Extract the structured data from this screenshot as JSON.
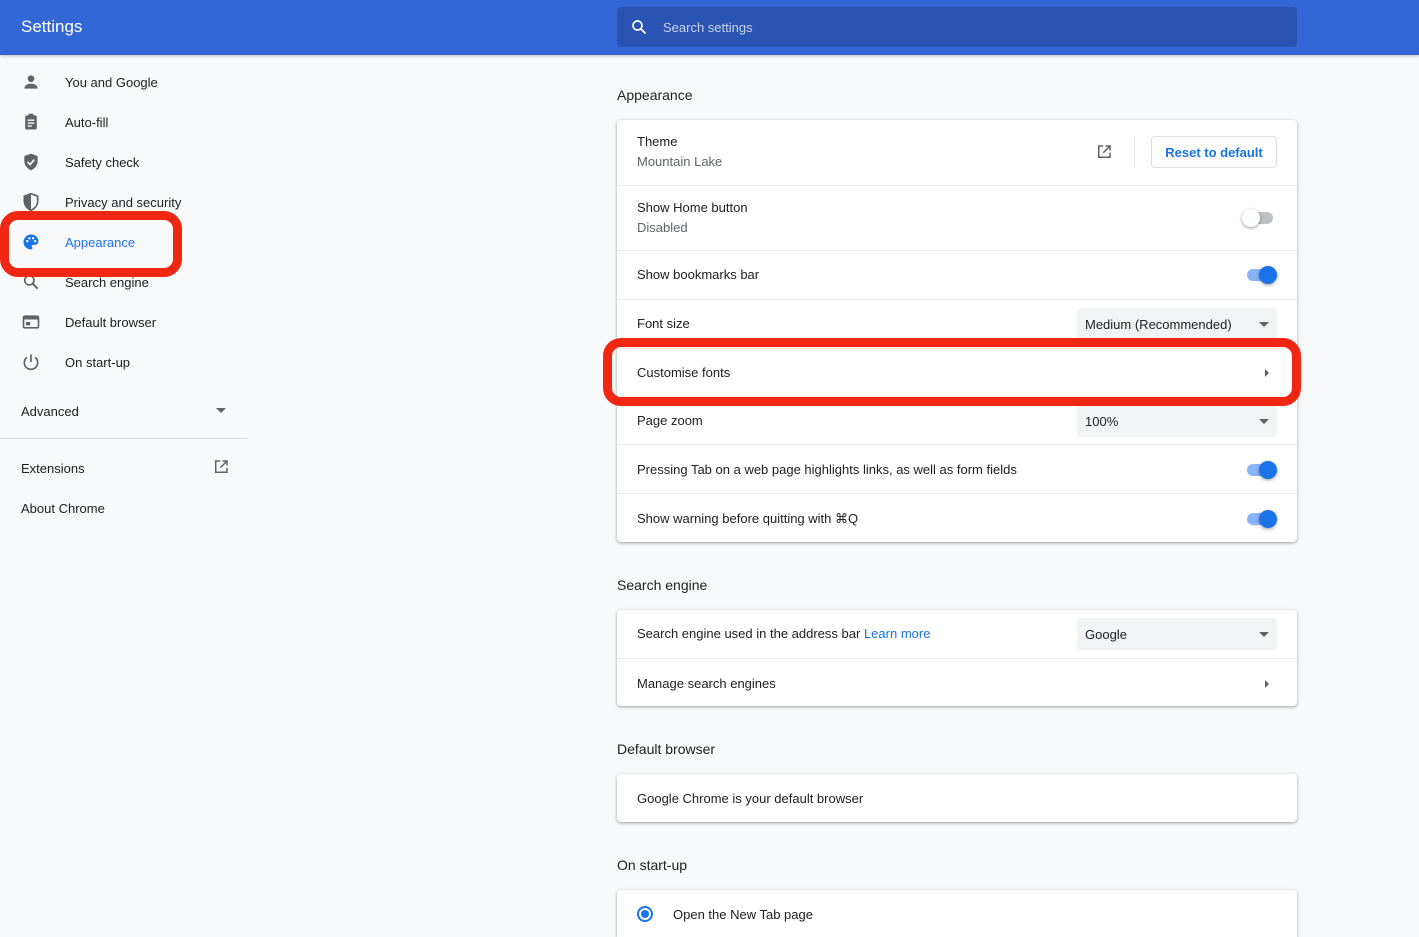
{
  "header": {
    "title": "Settings",
    "search_placeholder": "Search settings"
  },
  "sidebar": {
    "items": [
      {
        "label": "You and Google",
        "icon": "person-icon"
      },
      {
        "label": "Auto-fill",
        "icon": "clipboard-icon"
      },
      {
        "label": "Safety check",
        "icon": "shield-check-icon"
      },
      {
        "label": "Privacy and security",
        "icon": "shield-half-icon"
      },
      {
        "label": "Appearance",
        "icon": "palette-icon",
        "active": true
      },
      {
        "label": "Search engine",
        "icon": "search-icon"
      },
      {
        "label": "Default browser",
        "icon": "browser-icon"
      },
      {
        "label": "On start-up",
        "icon": "power-icon"
      }
    ],
    "advanced": "Advanced",
    "extensions": "Extensions",
    "about": "About Chrome"
  },
  "appearance": {
    "title": "Appearance",
    "theme_label": "Theme",
    "theme_value": "Mountain Lake",
    "reset_label": "Reset to default",
    "home_button_label": "Show Home button",
    "home_button_value": "Disabled",
    "bookmarks_label": "Show bookmarks bar",
    "font_size_label": "Font size",
    "font_size_value": "Medium (Recommended)",
    "customise_fonts_label": "Customise fonts",
    "page_zoom_label": "Page zoom",
    "page_zoom_value": "100%",
    "tab_highlight_label": "Pressing Tab on a web page highlights links, as well as form fields",
    "quit_warning_label": "Show warning before quitting with ⌘Q"
  },
  "search_engine": {
    "title": "Search engine",
    "used_label": "Search engine used in the address bar",
    "learn_more": "Learn more",
    "engine_value": "Google",
    "manage_label": "Manage search engines"
  },
  "default_browser": {
    "title": "Default browser",
    "status": "Google Chrome is your default browser"
  },
  "startup": {
    "title": "On start-up",
    "option_new_tab": "Open the New Tab page"
  },
  "colors": {
    "header": "#3367d6",
    "accent": "#1a73e8",
    "highlight": "#f22713"
  }
}
